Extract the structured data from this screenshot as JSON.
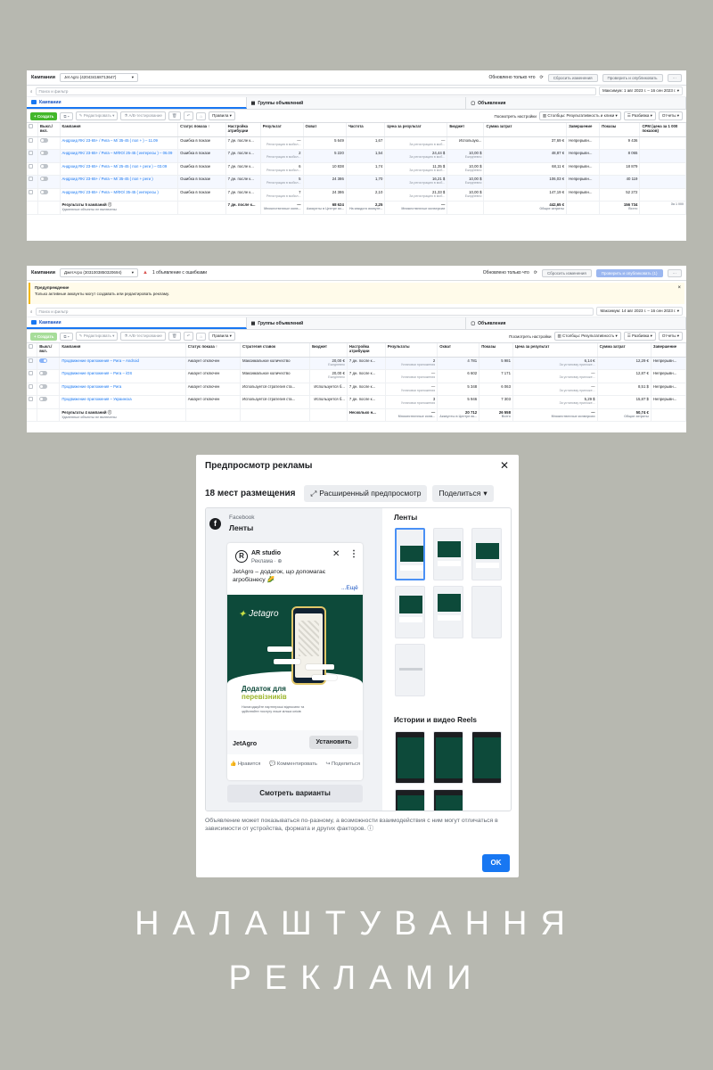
{
  "shot1": {
    "title": "Кампании",
    "account": "Jet Agro (420434168713647)",
    "updated": "Обновлено только что",
    "reset": "Сбросить изменения",
    "review": "Проверить и опубликовать",
    "more": "···",
    "search_placeholder": "Поиск и фильтр",
    "date_range": "Максимум: 1 авг 2023 г. – 16 сен 2023 г.",
    "tabs": [
      "Кампании",
      "Группы объявлений",
      "Объявления"
    ],
    "toolbar": {
      "create": "+ Создать",
      "edit": "Редактировать",
      "ab": "A/B-тестирование",
      "rules": "Правила",
      "view_settings": "Посмотреть настройки",
      "columns": "Столбцы: Результативность и клики",
      "breakdown": "Разбивка",
      "reports": "Отчеты"
    },
    "headers": [
      "Выкл./вкл.",
      "Кампания",
      "Статус показа ↑",
      "Настройка атрибуции",
      "Результат",
      "Охват",
      "Частота",
      "Цена за результат",
      "Бюджет",
      "Сумма затрат",
      "Завершение",
      "Показы",
      "CPM (цена за 1 000 показов)"
    ],
    "rows": [
      {
        "name": "Андроид RK/ 23-65+ / Рига – М/ 35-45 ( пол + ) – 11.09",
        "status": "Ошибка в показе",
        "attr": "7 дн. после к...",
        "result": "—",
        "result_sub": "Регистрация в мобил...",
        "reach": "5 649",
        "freq": "1,67",
        "cpr": "—",
        "cpr_sub": "За регистрацию в моб...",
        "budget": "Использую...",
        "budget_sub": "",
        "spent": "37,69 €",
        "end": "Непрерывн...",
        "impr": "9 436",
        "cpm": ""
      },
      {
        "name": "Андроид RK/ 23-65+ / Рига – М/ФО/ 25-45 ( интересы ) – 06.09",
        "status": "Ошибка в показе",
        "attr": "7 дн. после к...",
        "result": "2",
        "result_sub": "Регистрация в мобил...",
        "reach": "5 220",
        "freq": "1,54",
        "cpr": "24,44 $",
        "cpr_sub": "За регистрацию в моб...",
        "budget": "10,00 $",
        "budget_sub": "Ежедневно",
        "spent": "48,87 €",
        "end": "Непрерывн...",
        "impr": "8 065",
        "cpm": ""
      },
      {
        "name": "Андроид RK/ 23-65+ / Рига – М/ 25-45 ( пол + реги ) – 03.09",
        "status": "Ошибка в показе",
        "attr": "7 дн. после к...",
        "result": "6",
        "result_sub": "Регистрация в мобил...",
        "reach": "10 838",
        "freq": "1,74",
        "cpr": "11,35 $",
        "cpr_sub": "За регистрацию в моб...",
        "budget": "10,00 $",
        "budget_sub": "Ежедневно",
        "spent": "68,11 €",
        "end": "Непрерывн...",
        "impr": "18 879",
        "cpm": ""
      },
      {
        "name": "Андроид RK/ 23-65+ / Рига – М/ 35-45 ( пол + реги )",
        "status": "Ошибка в показе",
        "attr": "7 дн. после к...",
        "result": "5",
        "result_sub": "Регистрация в мобил...",
        "reach": "24 386",
        "freq": "1,70",
        "cpr": "16,21 $",
        "cpr_sub": "За регистрацию в моб...",
        "budget": "10,00 $",
        "budget_sub": "Ежедневно",
        "spent": "106,03 €",
        "end": "Непрерывн...",
        "impr": "40 119",
        "cpm": ""
      },
      {
        "name": "Андроид RK/ 23-65+ / Рига – М/ФО/ 35-45 ( интересы )",
        "status": "Ошибка в показе",
        "attr": "7 дн. после к...",
        "result": "7",
        "result_sub": "Регистрация в мобил...",
        "reach": "24 386",
        "freq": "2,10",
        "cpr": "21,33 $",
        "cpr_sub": "За регистрацию в моб...",
        "budget": "10,00 $",
        "budget_sub": "Ежедневно",
        "spent": "147,19 €",
        "end": "Непрерывн...",
        "impr": "52 272",
        "cpm": ""
      }
    ],
    "summary": {
      "name": "Результаты 5 кампаний ⓘ",
      "name_sub": "Удаленные объекты не включены",
      "attr": "7 дн. после к...",
      "result": "—",
      "result_sub": "Множественные конв...",
      "reach": "68 624",
      "reach_sub": "Аккаунты в Центре ак...",
      "freq": "2,25",
      "freq_sub": "На каждого аккаунт...",
      "cpr": "—",
      "cpr_sub": "Множественные конверсии",
      "spent": "442,65 €",
      "spent_sub": "Общие затраты",
      "impr": "156 734",
      "impr_sub": "Всего",
      "cpm_sub": "За 1 000"
    }
  },
  "shot2": {
    "title": "Кампании",
    "account": "ДжетАгро (3031003850320694)",
    "errors": "1 объявление с ошибками",
    "updated": "Обновлено только что",
    "reset": "Сбросить изменения",
    "review": "Проверить и опубликовать (1)",
    "warn_title": "Предупреждение",
    "warn_text": "Только активные аккаунты могут создавать или редактировать рекламу.",
    "search_placeholder": "Поиск и фильтр",
    "date_range": "Максимум: 14 авг 2023 г. – 16 сен 2023 г.",
    "tabs": [
      "Кампании",
      "Группы объявлений",
      "Объявления"
    ],
    "toolbar": {
      "create": "+ Создать",
      "edit": "Редактировать",
      "ab": "A/B-тестирование",
      "rules": "Правила",
      "view_settings": "Посмотреть настройки",
      "columns": "Столбцы: Результативность",
      "breakdown": "Разбивка",
      "reports": "Отчеты"
    },
    "headers": [
      "Выкл./вкл.",
      "Кампания",
      "Статус показа ↑",
      "Стратегия ставок",
      "Бюджет",
      "Настройка атрибуции",
      "Результаты",
      "Охват",
      "Показы",
      "Цена за результат",
      "Сумма затрат",
      "Завершение"
    ],
    "rows": [
      {
        "name": "Продвижение приложения – Рига – Android",
        "status": "Аккаунт отключен",
        "bid": "Максимальное количество",
        "budget": "20,00 €",
        "budget_sub": "Ежедневно",
        "attr": "7 дн. после к...",
        "result": "2",
        "result_sub": "Установки приложения",
        "reach": "4 781",
        "impr": "5 981",
        "cpr": "6,14 €",
        "cpr_sub": "За установку приложе...",
        "spent": "12,29 €",
        "end": "Непрерывн..."
      },
      {
        "name": "Продвижение приложения – Рига – iOS",
        "status": "Аккаунт отключен",
        "bid": "Максимальное количество",
        "budget": "20,00 €",
        "budget_sub": "Ежедневно",
        "attr": "7 дн. после к...",
        "result": "—",
        "result_sub": "Установки приложения",
        "reach": "6 602",
        "impr": "7 171",
        "cpr": "—",
        "cpr_sub": "За установку приложе...",
        "spent": "12,87 €",
        "end": "Непрерывн..."
      },
      {
        "name": "Продвижение приложения – Рига",
        "status": "Аккаунт отключен",
        "bid": "Используется стратегия ста...",
        "budget": "Используется б...",
        "budget_sub": "",
        "attr": "7 дн. после к...",
        "result": "—",
        "result_sub": "Установки приложения",
        "reach": "5 348",
        "impr": "6 063",
        "cpr": "—",
        "cpr_sub": "За установку приложе...",
        "spent": "8,51 $",
        "end": "Непрерывн..."
      },
      {
        "name": "Продвижение приложения – Украинска",
        "status": "Аккаунт отключен",
        "bid": "Используется стратегия ста...",
        "budget": "Используется б...",
        "budget_sub": "",
        "attr": "7 дн. после к...",
        "result": "3",
        "result_sub": "Установки приложения",
        "reach": "5 946",
        "impr": "7 303",
        "cpr": "5,29 $",
        "cpr_sub": "За установку приложе...",
        "spent": "15,87 $",
        "end": "Непрерывн..."
      }
    ],
    "summary": {
      "name": "Результаты 4 кампаний ⓘ",
      "name_sub": "Удаленные объекты не включены",
      "attr": "Несколько н...",
      "result": "—",
      "result_sub": "Множественные конв...",
      "reach": "20 712",
      "reach_sub": "Аккаунты в Центре ак...",
      "impr": "26 558",
      "impr_sub": "Всего",
      "cpr": "—",
      "cpr_sub": "Множественные конверсии",
      "spent": "50,74 €",
      "spent_sub": "Общие затраты"
    }
  },
  "modal": {
    "title": "Предпросмотр рекламы",
    "placements": "18 мест размещения",
    "advanced": "Расширенный предпросмотр",
    "share": "Поделиться",
    "platform": "Facebook",
    "placement": "Ленты",
    "page_name": "AR studio",
    "sponsored": "Реклама · ⊕",
    "ad_text": "JetAgro – додаток, що допомагає агробізнесу 🌽",
    "more": "...Ещё",
    "brand": "Jetagro",
    "headline_1": "Додаток для",
    "headline_2": "перевізників",
    "small_text": "Налагоджуйте партнерські відносини та здійснюйте послугу лише кілька кліків",
    "cta_name": "JetAgro",
    "cta_button": "Установить",
    "like": "Нравится",
    "comment": "Комментировать",
    "share_action": "Поделиться",
    "variants": "Смотреть варианты",
    "feeds_title": "Ленты",
    "stories_title": "Истории и видео Reels",
    "footnote": "Объявление может показываться по-разному, а возможности взаимодействия с ним могут отличаться в зависимости от устройства, формата и других факторов.",
    "ok": "OK"
  },
  "headline": {
    "line1": "НАЛАШТУВАННЯ",
    "line2": "РЕКЛАМИ"
  }
}
